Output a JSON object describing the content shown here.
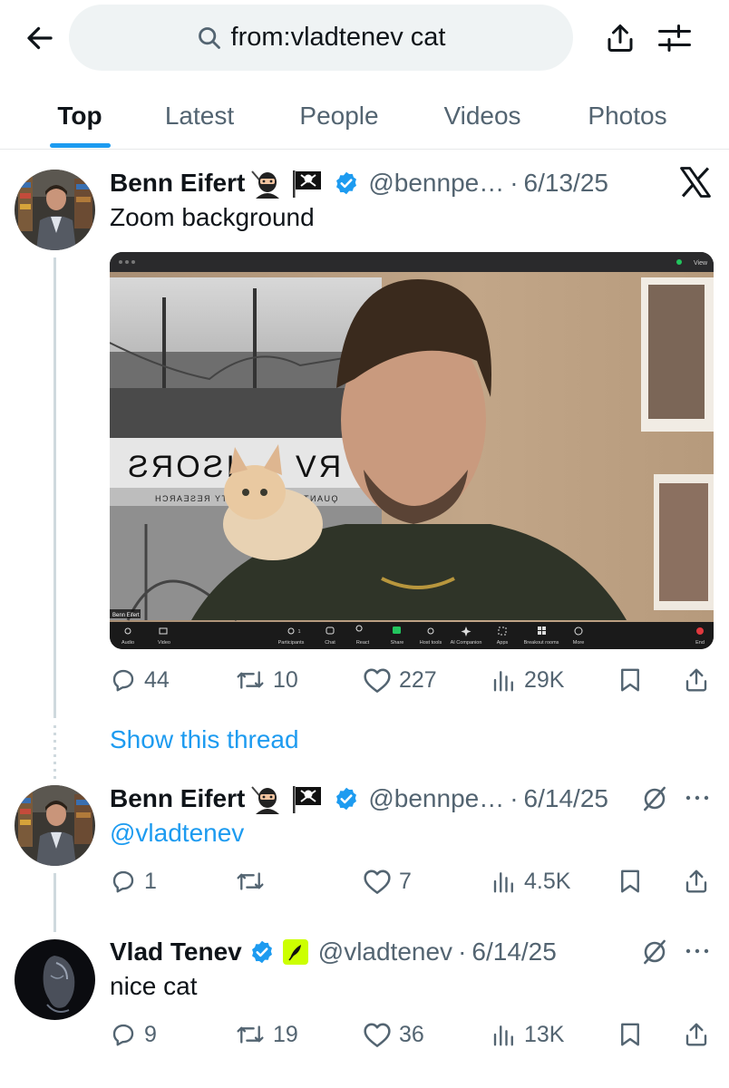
{
  "search": {
    "query": "from:vladtenev cat"
  },
  "tabs": [
    {
      "label": "Top",
      "active": true
    },
    {
      "label": "Latest"
    },
    {
      "label": "People"
    },
    {
      "label": "Videos"
    },
    {
      "label": "Photos"
    }
  ],
  "colors": {
    "accent": "#1d9bf0",
    "text": "#0f1419",
    "muted": "#536471",
    "verified": "#1d9bf0",
    "divider": "#e7e9ea"
  },
  "tweets": [
    {
      "name": "Benn Eifert",
      "emojis": [
        "ninja-emoji",
        "pirate-flag-emoji"
      ],
      "handle": "@bennpe…",
      "dot": "·",
      "date": "6/13/25",
      "text": "Zoom background",
      "thread_link": "Show this thread",
      "media": {
        "app_bar_right": "View",
        "bg_text_1": "ƧЯOƧI",
        "bg_text_2": "VЯ",
        "bg_text_3": "HƆЯAƎƧƎЯ YTI",
        "bg_text_4": "ITИAUϘ",
        "name_tag": "Benn Eifert",
        "toolbar": [
          "Audio",
          "Video",
          "Participants",
          "Chat",
          "React",
          "Share",
          "Host tools",
          "AI Companion",
          "Apps",
          "Breakout rooms",
          "More",
          "End"
        ],
        "participant_count": "1"
      },
      "stats": {
        "replies": "44",
        "reposts": "10",
        "likes": "227",
        "views": "29K"
      }
    },
    {
      "name": "Benn Eifert",
      "emojis": [
        "ninja-emoji",
        "pirate-flag-emoji"
      ],
      "handle": "@bennpe…",
      "dot": "·",
      "date": "6/14/25",
      "text": "@vladtenev",
      "stats": {
        "replies": "1",
        "reposts": "",
        "likes": "7",
        "views": "4.5K"
      }
    },
    {
      "name": "Vlad Tenev",
      "emojis": [
        "feather-emoji"
      ],
      "handle": "@vladtenev",
      "dot": "·",
      "date": "6/14/25",
      "text": "nice cat",
      "stats": {
        "replies": "9",
        "reposts": "19",
        "likes": "36",
        "views": "13K"
      }
    }
  ]
}
